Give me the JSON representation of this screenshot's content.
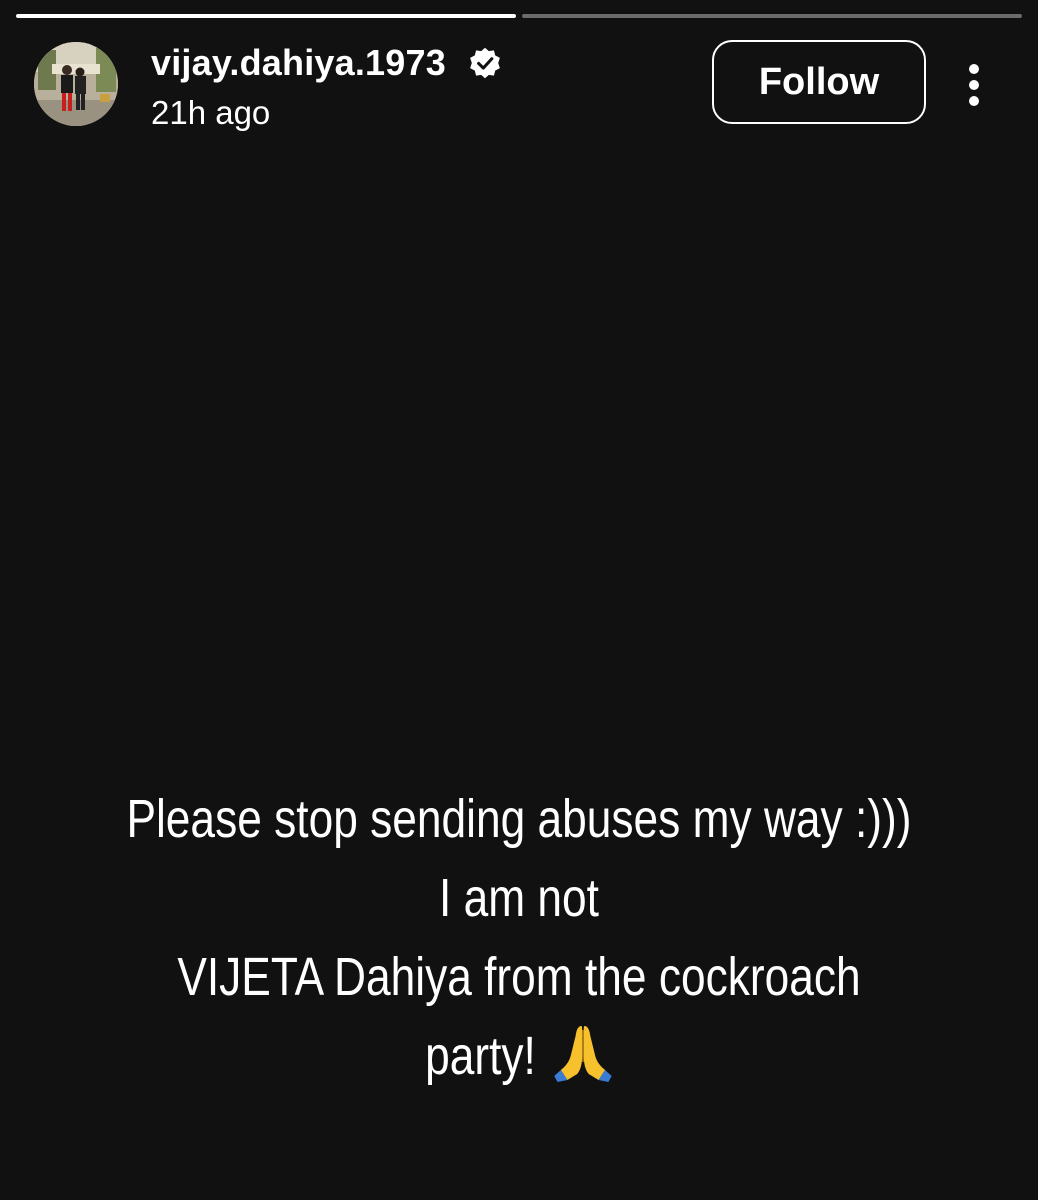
{
  "story": {
    "progress": [
      1.0,
      0.0
    ],
    "colors": {
      "background": "#111111",
      "progress_active": "#ffffff",
      "progress_inactive": "rgba(255,255,255,0.38)"
    }
  },
  "header": {
    "username": "vijay.dahiya.1973",
    "verified": true,
    "verified_icon": "verified-badge-icon",
    "timestamp": "21h ago",
    "follow_label": "Follow",
    "more_icon": "vertical-ellipsis-icon"
  },
  "content": {
    "lines": [
      "Please stop sending abuses my way :)))",
      "I am not",
      "VIJETA Dahiya from the cockroach",
      "party!"
    ],
    "emoji": "🙏",
    "emoji_icon": "folded-hands-icon"
  }
}
